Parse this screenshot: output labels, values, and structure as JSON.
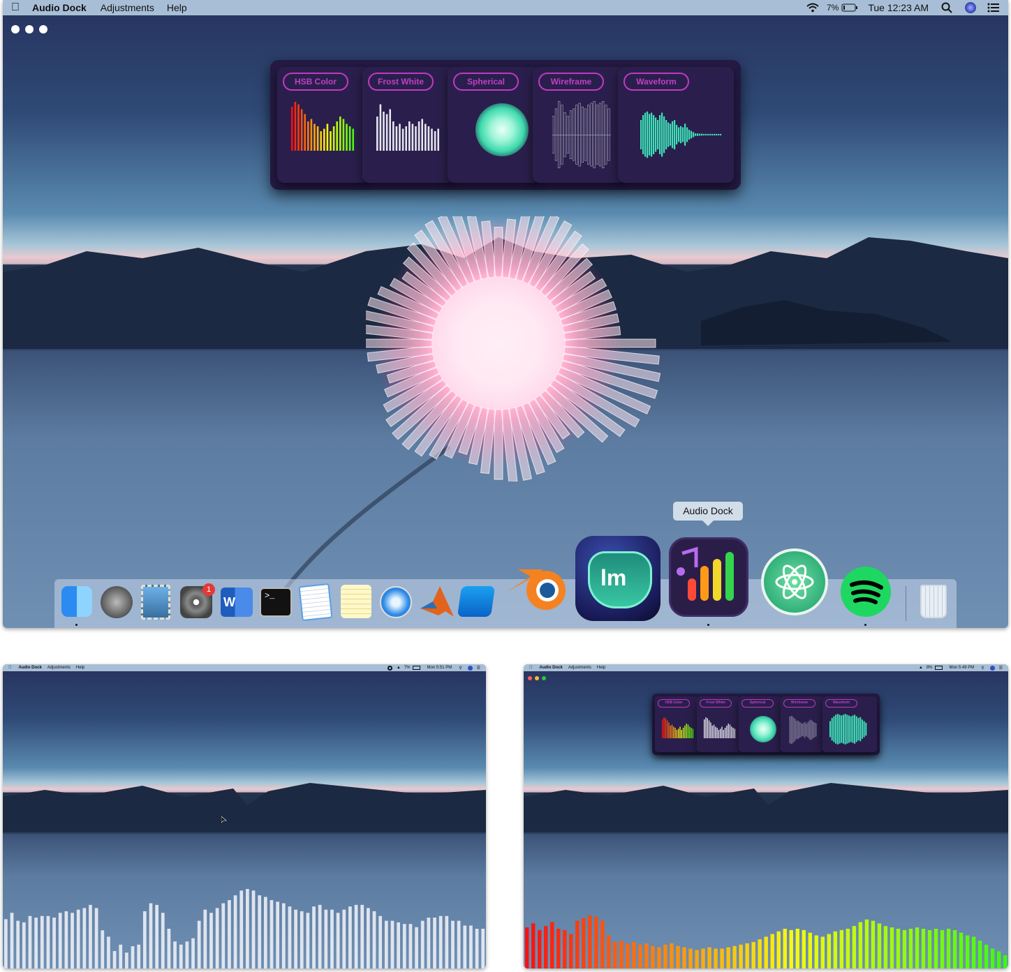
{
  "main": {
    "menubar": {
      "app_name": "Audio Dock",
      "menus": [
        "Adjustments",
        "Help"
      ],
      "battery": "7%",
      "clock": "Tue 12:23 AM"
    },
    "visualizers": [
      {
        "label": "HSB Color",
        "style": "bars-rainbow"
      },
      {
        "label": "Frost White",
        "style": "bars-white"
      },
      {
        "label": "Spherical",
        "style": "sphere-teal"
      },
      {
        "label": "Wireframe",
        "style": "wire-gray"
      },
      {
        "label": "Waveform",
        "style": "wave-teal"
      }
    ],
    "tooltip": "Audio Dock",
    "dock_apps": [
      "Finder",
      "Launchpad",
      "Mail",
      "System Preferences",
      "Microsoft Word",
      "Terminal",
      "TextEdit",
      "Notes",
      "Safari",
      "MATLAB",
      "Xcode",
      "Blender",
      "Luminar",
      "Audio Dock",
      "Atom",
      "Spotify",
      "Trash"
    ],
    "badge_count": "1",
    "colors": {
      "pill": "#c238c2",
      "card": "#2a1f4c",
      "teal": "#3fe0b8",
      "pink": "#ff4f9a"
    }
  },
  "left_preview": {
    "menubar": {
      "app_name": "Audio Dock",
      "menus": [
        "Adjustments",
        "Help"
      ],
      "battery": "7%",
      "clock": "Mon 5:51 PM"
    },
    "bar_levels": [
      0.62,
      0.7,
      0.6,
      0.58,
      0.66,
      0.64,
      0.66,
      0.66,
      0.64,
      0.7,
      0.72,
      0.7,
      0.74,
      0.76,
      0.8,
      0.76,
      0.48,
      0.4,
      0.22,
      0.3,
      0.2,
      0.28,
      0.3,
      0.72,
      0.82,
      0.8,
      0.7,
      0.5,
      0.34,
      0.3,
      0.34,
      0.38,
      0.6,
      0.74,
      0.7,
      0.76,
      0.82,
      0.86,
      0.92,
      0.98,
      1.0,
      0.98,
      0.92,
      0.9,
      0.86,
      0.84,
      0.82,
      0.78,
      0.74,
      0.72,
      0.7,
      0.78,
      0.8,
      0.74,
      0.74,
      0.7,
      0.74,
      0.78,
      0.8,
      0.8,
      0.76,
      0.72,
      0.66,
      0.6,
      0.6,
      0.58,
      0.56,
      0.56,
      0.52,
      0.6,
      0.64,
      0.64,
      0.66,
      0.66,
      0.6,
      0.6,
      0.54,
      0.54,
      0.5,
      0.5
    ]
  },
  "right_preview": {
    "menubar": {
      "app_name": "Audio Dock",
      "menus": [
        "Adjustments",
        "Help"
      ],
      "battery": "8%",
      "clock": "Mon 5:49 PM"
    },
    "visualizers": [
      "HSB Color",
      "Frost White",
      "Spherical",
      "Wireframe",
      "Waveform"
    ],
    "bar_levels": [
      0.62,
      0.68,
      0.58,
      0.64,
      0.7,
      0.6,
      0.58,
      0.52,
      0.72,
      0.76,
      0.8,
      0.78,
      0.72,
      0.5,
      0.4,
      0.42,
      0.38,
      0.4,
      0.36,
      0.38,
      0.34,
      0.32,
      0.36,
      0.38,
      0.34,
      0.32,
      0.3,
      0.28,
      0.3,
      0.32,
      0.3,
      0.3,
      0.32,
      0.34,
      0.36,
      0.38,
      0.4,
      0.44,
      0.48,
      0.52,
      0.56,
      0.6,
      0.58,
      0.6,
      0.58,
      0.54,
      0.5,
      0.48,
      0.52,
      0.56,
      0.58,
      0.6,
      0.64,
      0.7,
      0.74,
      0.72,
      0.68,
      0.64,
      0.62,
      0.6,
      0.58,
      0.6,
      0.62,
      0.6,
      0.58,
      0.6,
      0.58,
      0.6,
      0.58,
      0.54,
      0.5,
      0.48,
      0.42,
      0.36,
      0.3,
      0.26,
      0.2
    ]
  }
}
